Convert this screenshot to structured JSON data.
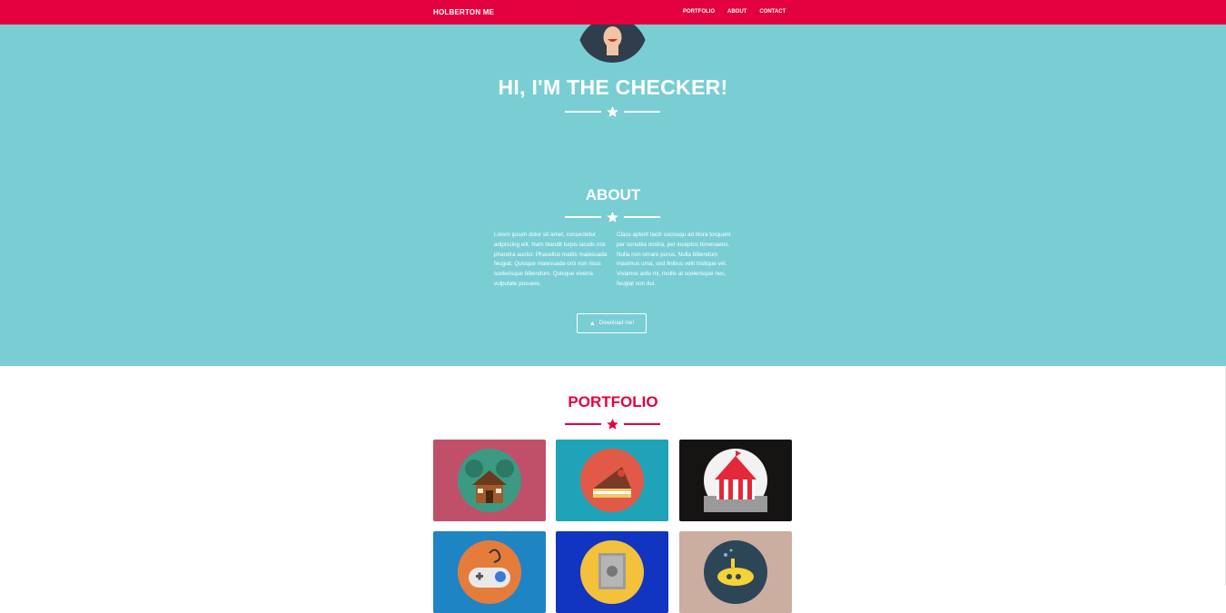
{
  "nav": {
    "brand": "HOLBERTON ME",
    "links": [
      "PORTFOLIO",
      "ABOUT",
      "CONTACT"
    ]
  },
  "hero": {
    "title": "HI, I'M THE CHECKER!"
  },
  "about": {
    "title": "ABOUT",
    "col1": "Lorem ipsum dolor sit amet, consectetur adipiscing elit. Nam blandit turpis iaculis nisl pharetra auctor. Phasellus mattis malesuada feugiat. Quisque malesuada orci non risus scelerisque bibendum. Quisque viverra vulputate posuere.",
    "col2": "Class aptent taciti sociosqu ad litora torquent per conubia nostra, per inceptos himenaeos. Nulla non ornare purus. Nulla bibendum maximus urna, sed finibus velit tristique vel. Vivamus ante mi, mollis at scelerisque nec, feugiat non dui.",
    "button": "Download me!",
    "button_icon": "download-icon"
  },
  "portfolio": {
    "title": "PORTFOLIO",
    "items": [
      {
        "name": "cabin",
        "bg": "#c0506a"
      },
      {
        "name": "cake",
        "bg": "#1fa3b9"
      },
      {
        "name": "circus",
        "bg": "#161313"
      },
      {
        "name": "game",
        "bg": "#1f84c4"
      },
      {
        "name": "safe",
        "bg": "#1135c0"
      },
      {
        "name": "submarine",
        "bg": "#cbaea0"
      }
    ]
  },
  "colors": {
    "primary": "#e3003f",
    "hero": "#79ced4"
  }
}
